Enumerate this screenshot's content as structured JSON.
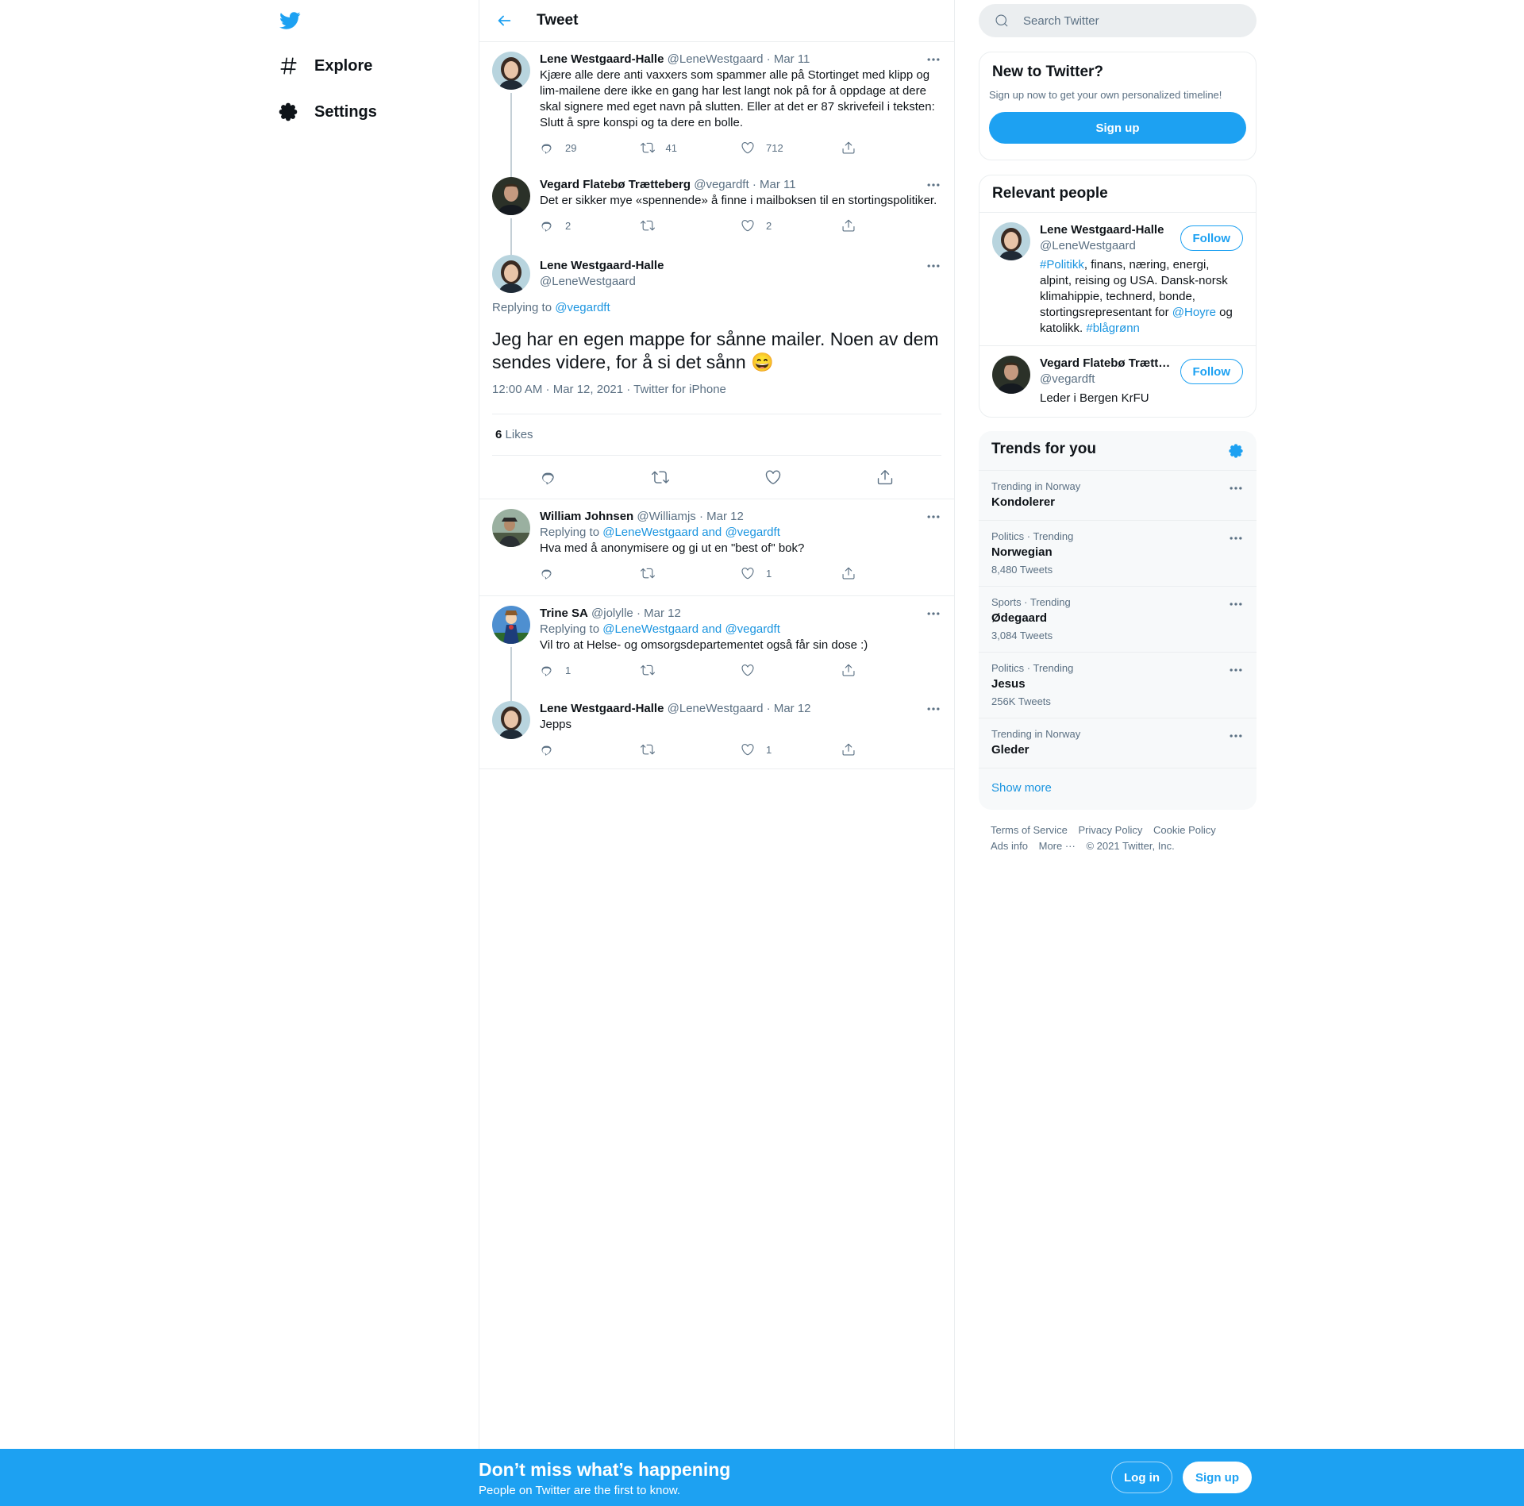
{
  "nav": {
    "explore_label": "Explore",
    "settings_label": "Settings"
  },
  "header": {
    "title": "Tweet"
  },
  "thread": [
    {
      "name": "Lene Westgaard-Halle",
      "handle": "@LeneWestgaard",
      "date": "· Mar 11",
      "text": "Kjære alle dere anti vaxxers som spammer alle på Stortinget med klipp og lim-mailene dere ikke en gang har lest langt nok på for å oppdage at dere skal signere med eget navn på slutten. Eller at det er 87 skrivefeil i teksten: Slutt å spre konspi og ta dere en bolle.",
      "replies": "29",
      "retweets": "41",
      "likes": "712"
    },
    {
      "name": "Vegard Flatebø Trætteberg",
      "handle": "@vegardft",
      "date": "· Mar 11",
      "text": "Det er sikker mye «spennende» å finne i mailboksen til en stortingspolitiker.",
      "replies": "2",
      "retweets": "",
      "likes": "2"
    }
  ],
  "focus": {
    "name": "Lene Westgaard-Halle",
    "handle": "@LeneWestgaard",
    "replying_prefix": "Replying to",
    "replying_to": "@vegardft",
    "text": "Jeg har en egen mappe for sånne mailer. Noen av dem sendes videre, for å si det sånn 😄",
    "meta": "12:00 AM · Mar 12, 2021 · Twitter for iPhone",
    "likes_count": "6",
    "likes_label": "Likes"
  },
  "replies": [
    {
      "name": "William Johnsen",
      "handle": "@Williamjs",
      "date": "· Mar 12",
      "replying_prefix": "Replying to",
      "replying_to": "@LeneWestgaard and @vegardft",
      "text": "Hva med å anonymisere og gi ut en \"best of\" bok?",
      "replies": "",
      "retweets": "",
      "likes": "1"
    },
    {
      "name": "Trine SA",
      "handle": "@jolylle",
      "date": "· Mar 12",
      "replying_prefix": "Replying to",
      "replying_to": "@LeneWestgaard and @vegardft",
      "text": "Vil tro at Helse- og omsorgsdepartementet også får sin dose :)",
      "replies": "1",
      "retweets": "",
      "likes": ""
    },
    {
      "name": "Lene Westgaard-Halle",
      "handle": "@LeneWestgaard",
      "date": "· Mar 12",
      "text": "Jepps",
      "replies": "",
      "retweets": "",
      "likes": "1"
    }
  ],
  "search": {
    "placeholder": "Search Twitter"
  },
  "new_to_twitter": {
    "title": "New to Twitter?",
    "subtitle": "Sign up now to get your own personalized timeline!",
    "button": "Sign up"
  },
  "relevant_people": {
    "title": "Relevant people",
    "people": [
      {
        "name": "Lene Westgaard-Halle",
        "handle": "@LeneWestgaard",
        "follow": "Follow",
        "bio_tag1": "#Politikk",
        "bio_part1": ", finans, næring, energi, alpint, reising og USA. Dansk-norsk klimahippie, technerd, bonde, stortingsrepresentant for ",
        "bio_mention": "@Hoyre",
        "bio_part2": " og katolikk. ",
        "bio_tag2": "#blågrønn"
      },
      {
        "name": "Vegard Flatebø Trætt…",
        "handle": "@vegardft",
        "follow": "Follow",
        "bio": "Leder i Bergen KrFU"
      }
    ]
  },
  "trends": {
    "title": "Trends for you",
    "items": [
      {
        "category": "Trending in Norway",
        "name": "Kondolerer",
        "count": ""
      },
      {
        "category": "Politics · Trending",
        "name": "Norwegian",
        "count": "8,480 Tweets"
      },
      {
        "category": "Sports · Trending",
        "name": "Ødegaard",
        "count": "3,084 Tweets"
      },
      {
        "category": "Politics · Trending",
        "name": "Jesus",
        "count": "256K Tweets"
      },
      {
        "category": "Trending in Norway",
        "name": "Gleder",
        "count": ""
      }
    ],
    "show_more": "Show more"
  },
  "footer": {
    "terms": "Terms of Service",
    "privacy": "Privacy Policy",
    "cookie": "Cookie Policy",
    "ads": "Ads info",
    "more": "More ···",
    "copyright": "© 2021 Twitter, Inc."
  },
  "bottom_bar": {
    "title": "Don’t miss what’s happening",
    "subtitle": "People on Twitter are the first to know.",
    "login": "Log in",
    "signup": "Sign up"
  },
  "colors": {
    "accent": "#1da1f2",
    "link": "#1b95e0",
    "secondary_text": "#5b7083",
    "border": "#ebeef0"
  }
}
